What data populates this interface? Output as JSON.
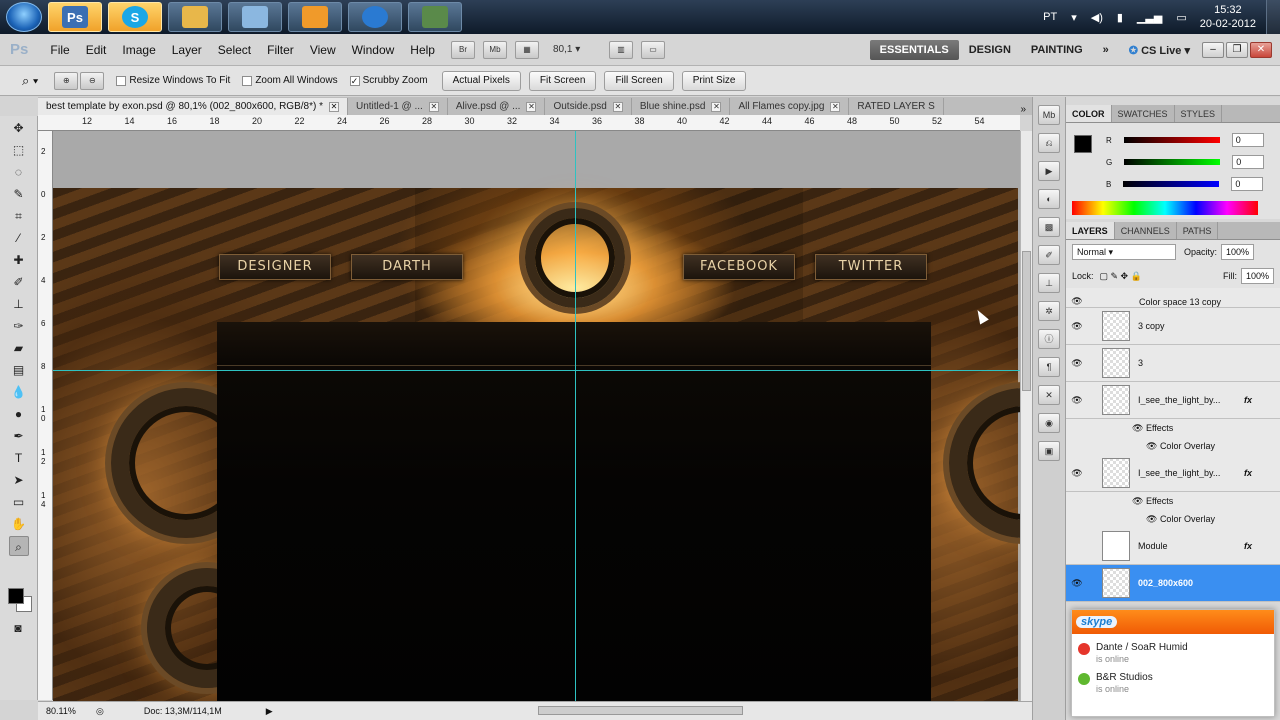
{
  "taskbar": {
    "apps": [
      {
        "name": "photoshop",
        "glyph": "Ps",
        "color": "#3b6fb3"
      },
      {
        "name": "skype",
        "glyph": "S",
        "color": "#1aa7e6"
      },
      {
        "name": "explorer",
        "glyph": "",
        "color": "#e8b74a"
      },
      {
        "name": "notepad",
        "glyph": "",
        "color": "#8bb7e0"
      },
      {
        "name": "media-player",
        "glyph": "",
        "color": "#f09a2a"
      },
      {
        "name": "camtasia",
        "glyph": "",
        "color": "#2a7ad2"
      },
      {
        "name": "other-app",
        "glyph": "",
        "color": "#5a8a4a"
      }
    ],
    "tray": {
      "language": "PT",
      "time": "15:32",
      "date": "20-02-2012"
    }
  },
  "appbar": {
    "menu": [
      "File",
      "Edit",
      "Image",
      "Layer",
      "Select",
      "Filter",
      "View",
      "Window",
      "Help"
    ],
    "zoom": "80,1",
    "workspaces": [
      "ESSENTIALS",
      "DESIGN",
      "PAINTING"
    ],
    "cs_live": "CS Live"
  },
  "options": {
    "resize_windows": "Resize Windows To Fit",
    "zoom_all": "Zoom All Windows",
    "scrubby": "Scrubby Zoom",
    "buttons": [
      "Actual Pixels",
      "Fit Screen",
      "Fill Screen",
      "Print Size"
    ]
  },
  "tabs": [
    {
      "label": "best template by exon.psd @ 80,1% (002_800x600, RGB/8*) *",
      "active": true
    },
    {
      "label": "Untitled-1 @ ...",
      "active": false
    },
    {
      "label": "Alive.psd @ ...",
      "active": false
    },
    {
      "label": "Outside.psd",
      "active": false
    },
    {
      "label": "Blue shine.psd",
      "active": false
    },
    {
      "label": "All Flames copy.jpg",
      "active": false
    },
    {
      "label": "RATED LAYER S",
      "active": false
    }
  ],
  "ruler": {
    "top": [
      "12",
      "14",
      "16",
      "18",
      "20",
      "22",
      "24",
      "26",
      "28",
      "30",
      "32",
      "34",
      "36",
      "38",
      "40",
      "42",
      "44",
      "46",
      "48",
      "50",
      "52",
      "54"
    ],
    "left": [
      "2",
      "0",
      "2",
      "4",
      "6",
      "8",
      "1 0",
      "1 2",
      "1 4"
    ]
  },
  "artwork": {
    "nav": [
      "DESIGNER",
      "DARTH",
      "FACEBOOK",
      "TWITTER"
    ]
  },
  "status": {
    "zoom": "80.11%",
    "doc": "Doc: 13,3M/114,1M"
  },
  "color_panel": {
    "tabs": [
      "COLOR",
      "SWATCHES",
      "STYLES"
    ],
    "r_label": "R",
    "g_label": "G",
    "b_label": "B",
    "r": "0",
    "g": "0",
    "b": "0"
  },
  "layers_panel": {
    "tabs": [
      "LAYERS",
      "CHANNELS",
      "PATHS"
    ],
    "blend_mode": "Normal",
    "opacity_label": "Opacity:",
    "opacity": "100%",
    "lock_label": "Lock:",
    "fill_label": "Fill:",
    "fill": "100%",
    "layers": [
      {
        "name": "Color space 13 copy",
        "fx": false
      },
      {
        "name": "3 copy",
        "fx": false
      },
      {
        "name": "3",
        "fx": false
      },
      {
        "name": "I_see_the_light_by...",
        "fx": true,
        "effects": "Effects",
        "overlay": "Color Overlay"
      },
      {
        "name": "I_see_the_light_by...",
        "fx": true,
        "effects": "Effects",
        "overlay": "Color Overlay"
      },
      {
        "name": "Module",
        "fx": true
      },
      {
        "name": "002_800x600",
        "fx": false,
        "selected": true
      }
    ]
  },
  "skype": {
    "logo": "skype",
    "contacts": [
      {
        "name": "Dante / SoaR Humid",
        "status": "is online",
        "color": "#e5352b"
      },
      {
        "name": "B&R Studios",
        "status": "is online",
        "color": "#5fb82f"
      }
    ]
  }
}
